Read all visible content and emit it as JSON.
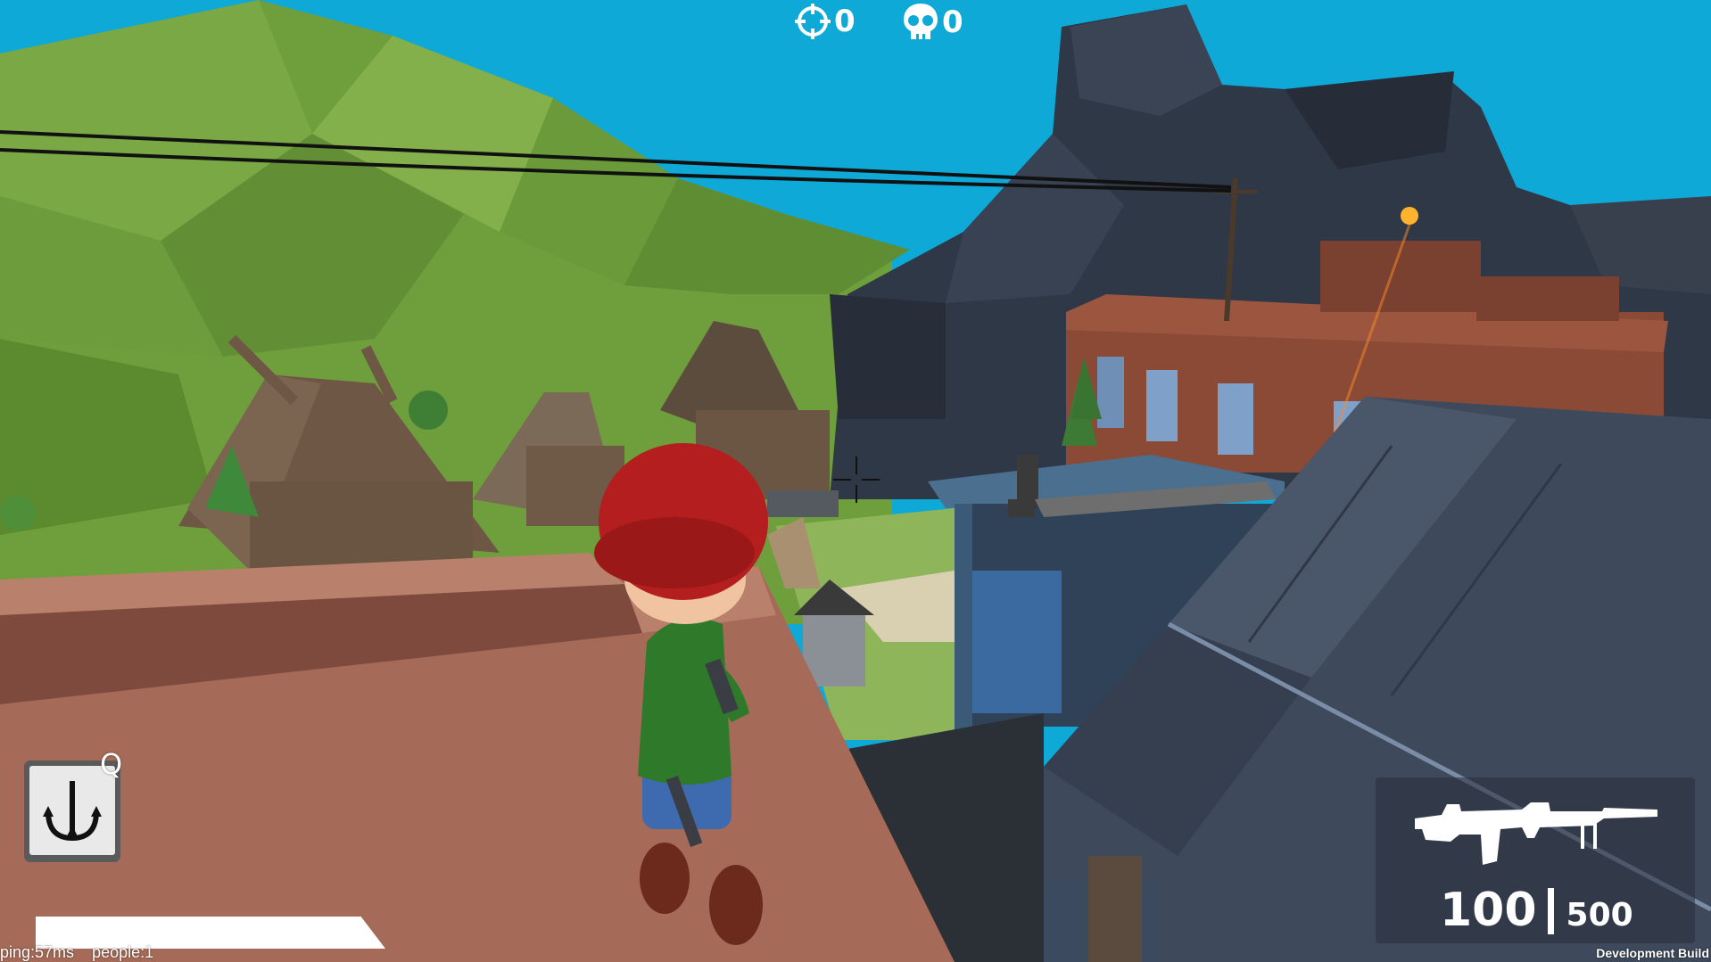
{
  "hud": {
    "kills_icon": "crosshair-target-icon",
    "kills_count": "0",
    "deaths_icon": "skull-icon",
    "deaths_count": "0",
    "crosshair_icon": "crosshair-icon"
  },
  "ability": {
    "icon": "grappling-hook-icon",
    "hotkey": "Q"
  },
  "health": {
    "fraction": 1.0,
    "color": "#ffffff"
  },
  "network": {
    "ping": "ping:57ms",
    "people": "people:1"
  },
  "weapon": {
    "icon": "machine-gun-icon",
    "magazine": "100",
    "reserve": "500"
  },
  "build_label": "Development Build",
  "colors": {
    "sky": "#0fa9d8",
    "hill": "#6f9e3c",
    "roof_terracotta": "#a66a58",
    "brick": "#8a4a35",
    "slate_roof": "#3e4a5c",
    "helmet_red": "#b41e1e",
    "shirt_green": "#2f7a2a"
  }
}
